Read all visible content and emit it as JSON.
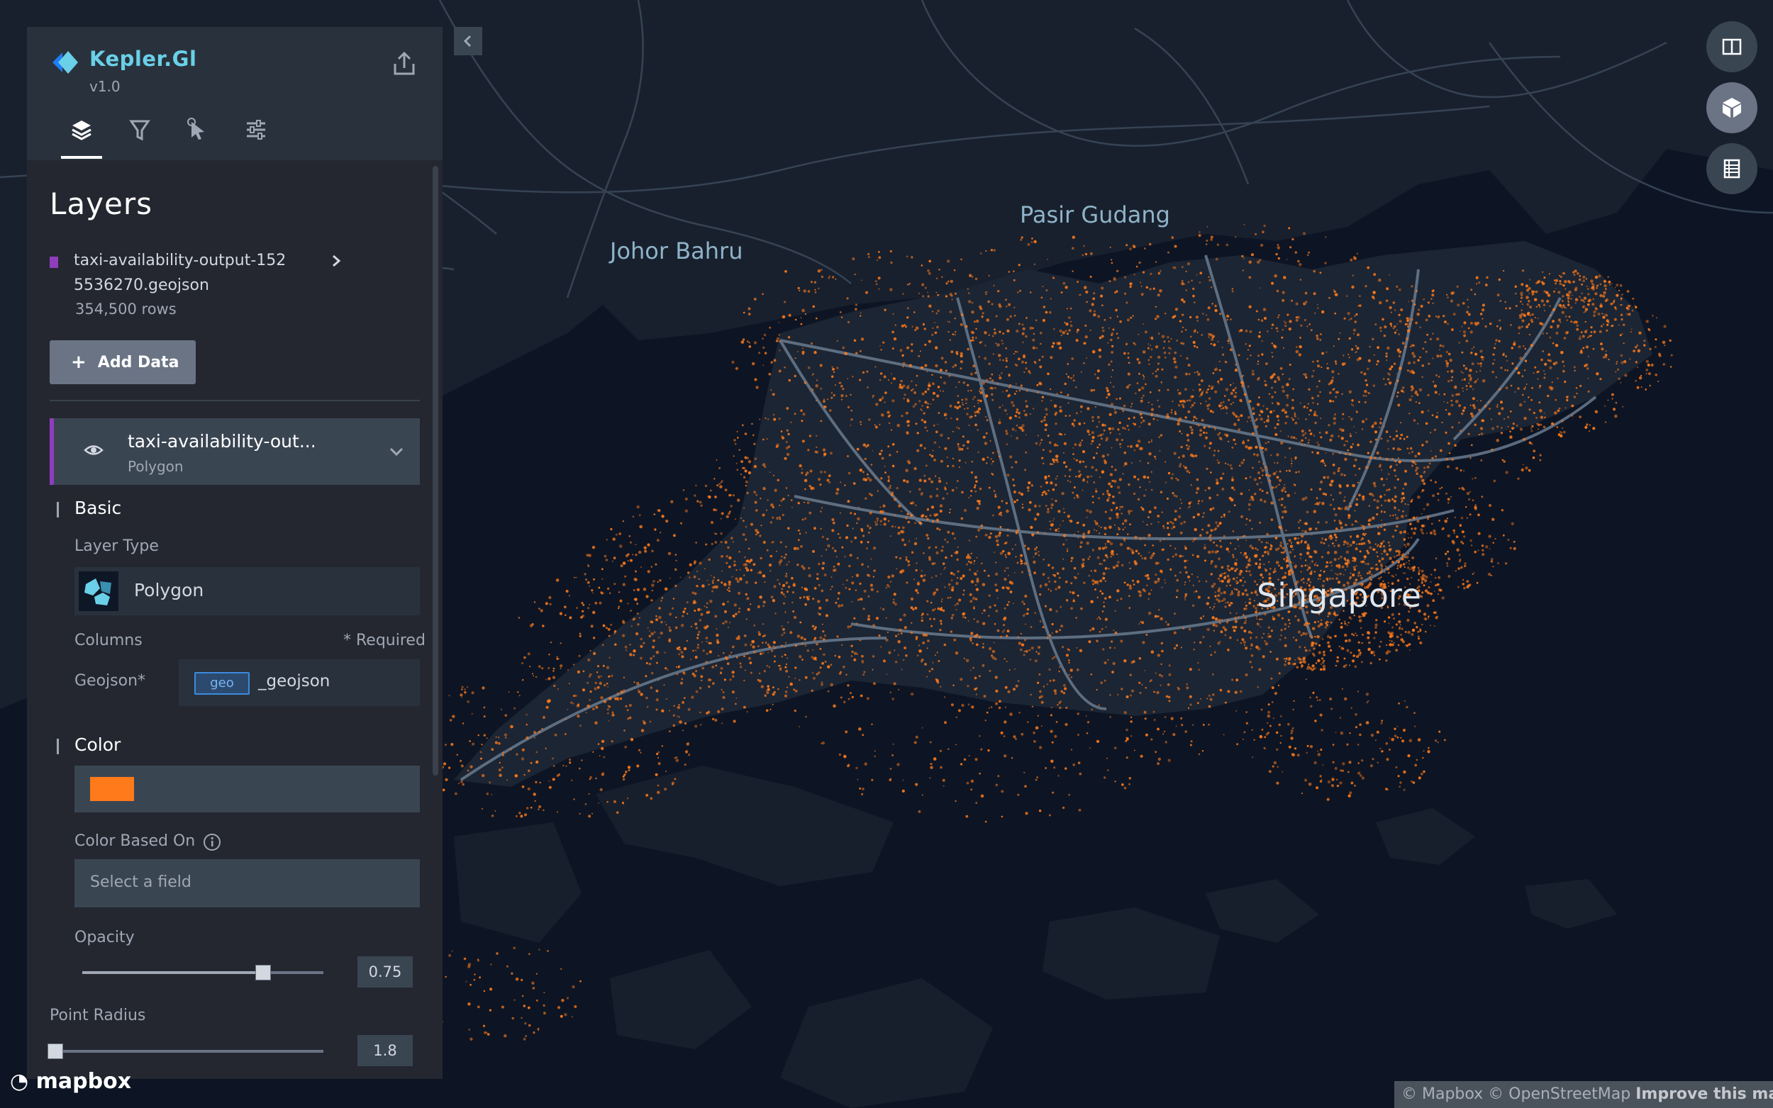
{
  "app": {
    "name": "Kepler.Gl",
    "version": "v1.0"
  },
  "sidebar": {
    "tabs": [
      {
        "icon": "layers-icon",
        "active": true
      },
      {
        "icon": "filter-icon",
        "active": false
      },
      {
        "icon": "interaction-pointer-icon",
        "active": false
      },
      {
        "icon": "map-settings-sliders-icon",
        "active": false
      }
    ],
    "title": "Layers",
    "dataset": {
      "name": "taxi-availability-output-1525536270.geojson",
      "rows": "354,500 rows",
      "color": "#8e3dbd"
    },
    "add_data_label": "Add Data",
    "layer": {
      "name": "taxi-availability-out...",
      "type": "Polygon",
      "visible": true,
      "color_accent": "#8e3dbd"
    },
    "basic": {
      "title": "Basic",
      "layer_type_label": "Layer Type",
      "layer_type_value": "Polygon",
      "columns_label": "Columns",
      "required_label": "* Required",
      "geojson_label": "Geojson*",
      "geojson_pill": "geo",
      "geojson_field": "_geojson"
    },
    "color": {
      "title": "Color",
      "swatch": "#ff7a1a",
      "based_on_label": "Color Based On",
      "based_on_placeholder": "Select a field",
      "opacity_label": "Opacity",
      "opacity_value": "0.75",
      "opacity_fraction": 0.75,
      "radius_label": "Point Radius",
      "radius_value": "1.8",
      "radius_fraction": 0.0
    }
  },
  "map": {
    "labels": {
      "johor": "Johor Bahru",
      "pasir": "Pasir Gudang",
      "singapore": "Singapore"
    },
    "controls": [
      "split-map-icon",
      "3d-view-icon",
      "data-table-icon"
    ],
    "attribution_prefix": "© Mapbox © OpenStreetMap",
    "attribution_link": "Improve this map",
    "mapbox_logo_text": "mapbox",
    "point_color": "#ff7a1a",
    "land_color": "#1b2331",
    "water_color": "#0e1726"
  }
}
